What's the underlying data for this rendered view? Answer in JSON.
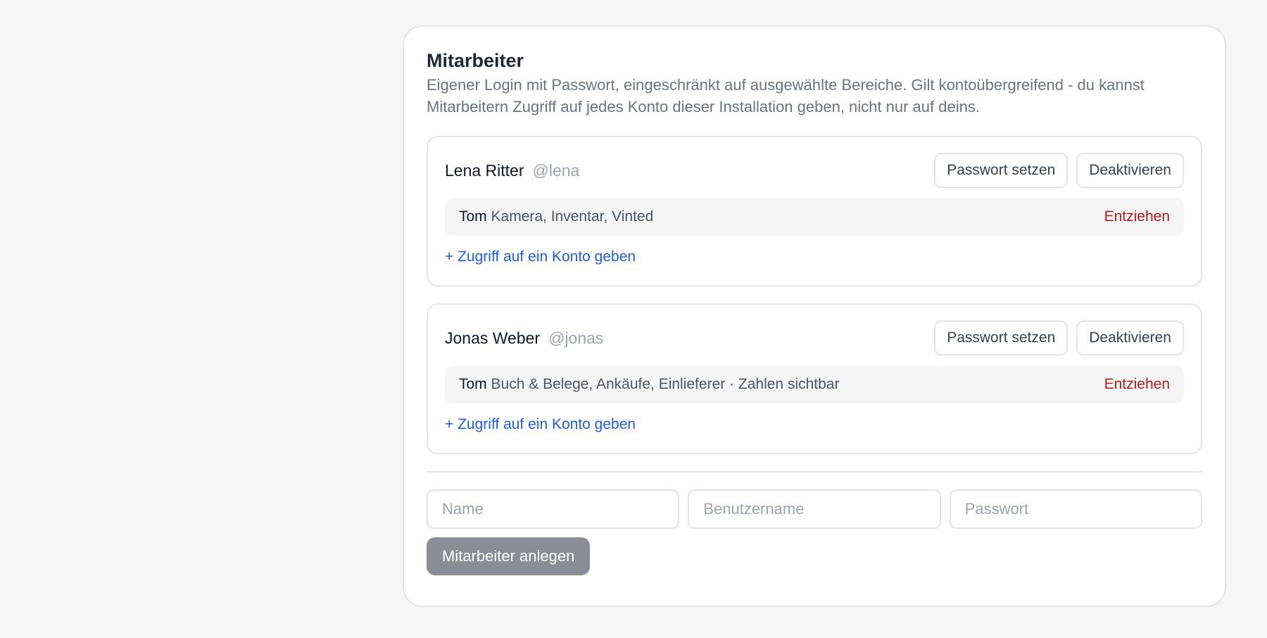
{
  "section": {
    "title": "Mitarbeiter",
    "description": "Eigener Login mit Passwort, eingeschränkt auf ausgewählte Bereiche. Gilt kontoübergreifend - du kannst Mitarbeitern Zugriff auf jedes Konto dieser Installation geben, nicht nur auf deins."
  },
  "employees": [
    {
      "name": "Lena Ritter",
      "handle": "@lena",
      "set_password_label": "Passwort setzen",
      "deactivate_label": "Deaktivieren",
      "access": {
        "account": "Tom",
        "scopes": "Kamera, Inventar, Vinted",
        "revoke_label": "Entziehen"
      },
      "grant_label": "+ Zugriff auf ein Konto geben"
    },
    {
      "name": "Jonas Weber",
      "handle": "@jonas",
      "set_password_label": "Passwort setzen",
      "deactivate_label": "Deaktivieren",
      "access": {
        "account": "Tom",
        "scopes": "Buch & Belege, Ankäufe, Einlieferer · Zahlen sichtbar",
        "revoke_label": "Entziehen"
      },
      "grant_label": "+ Zugriff auf ein Konto geben"
    }
  ],
  "new_employee": {
    "name_placeholder": "Name",
    "username_placeholder": "Benutzername",
    "password_placeholder": "Passwort",
    "name_value": "",
    "username_value": "",
    "password_value": "",
    "create_label": "Mitarbeiter anlegen"
  },
  "colors": {
    "background": "#f6f6f7",
    "card": "#ffffff",
    "border": "#e4e4e7",
    "link": "#1d5ee8",
    "danger": "#b91c1c",
    "primary_disabled": "#8b8d96"
  }
}
